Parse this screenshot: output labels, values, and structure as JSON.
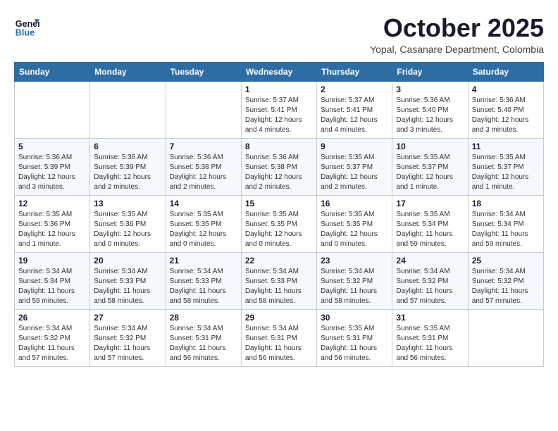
{
  "logo": {
    "line1": "General",
    "line2": "Blue"
  },
  "title": "October 2025",
  "subtitle": "Yopal, Casanare Department, Colombia",
  "weekdays": [
    "Sunday",
    "Monday",
    "Tuesday",
    "Wednesday",
    "Thursday",
    "Friday",
    "Saturday"
  ],
  "weeks": [
    [
      {
        "day": "",
        "detail": ""
      },
      {
        "day": "",
        "detail": ""
      },
      {
        "day": "",
        "detail": ""
      },
      {
        "day": "1",
        "detail": "Sunrise: 5:37 AM\nSunset: 5:41 PM\nDaylight: 12 hours\nand 4 minutes."
      },
      {
        "day": "2",
        "detail": "Sunrise: 5:37 AM\nSunset: 5:41 PM\nDaylight: 12 hours\nand 4 minutes."
      },
      {
        "day": "3",
        "detail": "Sunrise: 5:36 AM\nSunset: 5:40 PM\nDaylight: 12 hours\nand 3 minutes."
      },
      {
        "day": "4",
        "detail": "Sunrise: 5:36 AM\nSunset: 5:40 PM\nDaylight: 12 hours\nand 3 minutes."
      }
    ],
    [
      {
        "day": "5",
        "detail": "Sunrise: 5:36 AM\nSunset: 5:39 PM\nDaylight: 12 hours\nand 3 minutes."
      },
      {
        "day": "6",
        "detail": "Sunrise: 5:36 AM\nSunset: 5:39 PM\nDaylight: 12 hours\nand 2 minutes."
      },
      {
        "day": "7",
        "detail": "Sunrise: 5:36 AM\nSunset: 5:38 PM\nDaylight: 12 hours\nand 2 minutes."
      },
      {
        "day": "8",
        "detail": "Sunrise: 5:36 AM\nSunset: 5:38 PM\nDaylight: 12 hours\nand 2 minutes."
      },
      {
        "day": "9",
        "detail": "Sunrise: 5:35 AM\nSunset: 5:37 PM\nDaylight: 12 hours\nand 2 minutes."
      },
      {
        "day": "10",
        "detail": "Sunrise: 5:35 AM\nSunset: 5:37 PM\nDaylight: 12 hours\nand 1 minute."
      },
      {
        "day": "11",
        "detail": "Sunrise: 5:35 AM\nSunset: 5:37 PM\nDaylight: 12 hours\nand 1 minute."
      }
    ],
    [
      {
        "day": "12",
        "detail": "Sunrise: 5:35 AM\nSunset: 5:36 PM\nDaylight: 12 hours\nand 1 minute."
      },
      {
        "day": "13",
        "detail": "Sunrise: 5:35 AM\nSunset: 5:36 PM\nDaylight: 12 hours\nand 0 minutes."
      },
      {
        "day": "14",
        "detail": "Sunrise: 5:35 AM\nSunset: 5:35 PM\nDaylight: 12 hours\nand 0 minutes."
      },
      {
        "day": "15",
        "detail": "Sunrise: 5:35 AM\nSunset: 5:35 PM\nDaylight: 12 hours\nand 0 minutes."
      },
      {
        "day": "16",
        "detail": "Sunrise: 5:35 AM\nSunset: 5:35 PM\nDaylight: 12 hours\nand 0 minutes."
      },
      {
        "day": "17",
        "detail": "Sunrise: 5:35 AM\nSunset: 5:34 PM\nDaylight: 11 hours\nand 59 minutes."
      },
      {
        "day": "18",
        "detail": "Sunrise: 5:34 AM\nSunset: 5:34 PM\nDaylight: 11 hours\nand 59 minutes."
      }
    ],
    [
      {
        "day": "19",
        "detail": "Sunrise: 5:34 AM\nSunset: 5:34 PM\nDaylight: 11 hours\nand 59 minutes."
      },
      {
        "day": "20",
        "detail": "Sunrise: 5:34 AM\nSunset: 5:33 PM\nDaylight: 11 hours\nand 58 minutes."
      },
      {
        "day": "21",
        "detail": "Sunrise: 5:34 AM\nSunset: 5:33 PM\nDaylight: 11 hours\nand 58 minutes."
      },
      {
        "day": "22",
        "detail": "Sunrise: 5:34 AM\nSunset: 5:33 PM\nDaylight: 11 hours\nand 58 minutes."
      },
      {
        "day": "23",
        "detail": "Sunrise: 5:34 AM\nSunset: 5:32 PM\nDaylight: 11 hours\nand 58 minutes."
      },
      {
        "day": "24",
        "detail": "Sunrise: 5:34 AM\nSunset: 5:32 PM\nDaylight: 11 hours\nand 57 minutes."
      },
      {
        "day": "25",
        "detail": "Sunrise: 5:34 AM\nSunset: 5:32 PM\nDaylight: 11 hours\nand 57 minutes."
      }
    ],
    [
      {
        "day": "26",
        "detail": "Sunrise: 5:34 AM\nSunset: 5:32 PM\nDaylight: 11 hours\nand 57 minutes."
      },
      {
        "day": "27",
        "detail": "Sunrise: 5:34 AM\nSunset: 5:32 PM\nDaylight: 11 hours\nand 57 minutes."
      },
      {
        "day": "28",
        "detail": "Sunrise: 5:34 AM\nSunset: 5:31 PM\nDaylight: 11 hours\nand 56 minutes."
      },
      {
        "day": "29",
        "detail": "Sunrise: 5:34 AM\nSunset: 5:31 PM\nDaylight: 11 hours\nand 56 minutes."
      },
      {
        "day": "30",
        "detail": "Sunrise: 5:35 AM\nSunset: 5:31 PM\nDaylight: 11 hours\nand 56 minutes."
      },
      {
        "day": "31",
        "detail": "Sunrise: 5:35 AM\nSunset: 5:31 PM\nDaylight: 11 hours\nand 56 minutes."
      },
      {
        "day": "",
        "detail": ""
      }
    ]
  ]
}
